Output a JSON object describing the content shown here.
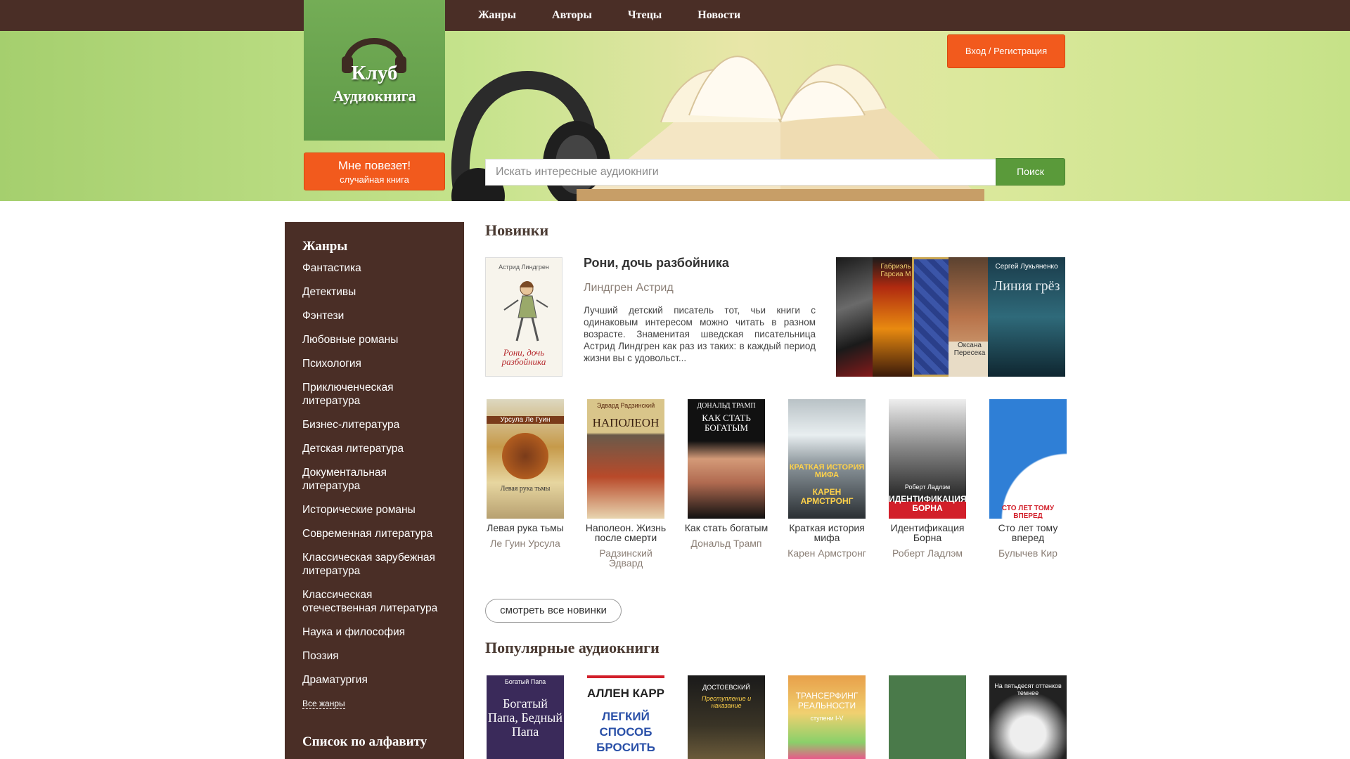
{
  "nav": {
    "items": [
      "Жанры",
      "Авторы",
      "Чтецы",
      "Новости"
    ]
  },
  "logo": {
    "title": "Клуб",
    "subtitle": "Аудиокнига",
    "icon": "headphones-icon"
  },
  "lucky": {
    "main": "Мне повезет!",
    "sub": "случайная книга"
  },
  "login": {
    "label": "Вход / Регистрация"
  },
  "search": {
    "placeholder": "Искать интересные аудиокниги",
    "button": "Поиск"
  },
  "sidebar": {
    "genres_heading": "Жанры",
    "genres": [
      "Фантастика",
      "Детективы",
      "Фэнтези",
      "Любовные романы",
      "Психология",
      "Приключенческая литература",
      "Бизнес-литература",
      "Детская литература",
      "Документальная литература",
      "Исторические романы",
      "Современная литература",
      "Классическая зарубежная литература",
      "Классическая отечественная литература",
      "Наука и философия",
      "Поэзия",
      "Драматургия"
    ],
    "all_genres": "Все жанры",
    "alphabet_heading": "Список по алфавиту"
  },
  "new_section": {
    "title": "Новинки",
    "featured": {
      "title": "Рони, дочь разбойника",
      "author": "Линдгрен Астрид",
      "description": "Лучший детский писатель тот, чьи книги с одинаковым интересом можно читать в разном возрасте. Знаменитая шведская писательница Астрид Линдгрен как раз из таких: в каждый период жизни вы с удовольст...",
      "cover_author": "Астрид Линдгрен",
      "cover_title": "Рони, дочь разбойника"
    },
    "stack_covers": [
      {
        "text": "Габриэль Гарсиа М"
      },
      {
        "text": "Оксана Пересека"
      },
      {
        "text": "Сергей Лукьяненко"
      },
      {
        "text": "Линия грёз"
      }
    ],
    "books": [
      {
        "title": "Левая рука тьмы",
        "author": "Ле Гуин Урсула",
        "cover_top": "Урсула Ле Гуин",
        "cover_bottom": "Левая рука тьмы"
      },
      {
        "title": "Наполеон. Жизнь после смерти",
        "author": "Радзинский Эдвард",
        "cover_top": "Эдвард Радзинский",
        "cover_bottom": "НАПОЛЕОН"
      },
      {
        "title": "Как стать богатым",
        "author": "Дональд Трамп",
        "cover_top": "ДОНАЛЬД ТРАМП",
        "cover_bottom": "КАК СТАТЬ БОГАТЫМ"
      },
      {
        "title": "Краткая история мифа",
        "author": "Карен Армстронг",
        "cover_top": "КРАТКАЯ ИСТОРИЯ МИФА",
        "cover_bottom": "КАРЕН АРМСТРОНГ"
      },
      {
        "title": "Идентификация Борна",
        "author": "Роберт Ладлэм",
        "cover_top": "Роберт Ладлэм",
        "cover_bottom": "ИДЕНТИФИКАЦИЯ БОРНА"
      },
      {
        "title": "Сто лет тому вперед",
        "author": "Булычев Кир",
        "cover_top": "",
        "cover_bottom": "СТО ЛЕТ ТОМУ ВПЕРЕД"
      }
    ],
    "more_button": "смотреть все новинки"
  },
  "popular_section": {
    "title": "Популярные аудиокниги",
    "covers": [
      {
        "top": "Богатый Папа",
        "main": "Богатый Папа, Бедный Папа"
      },
      {
        "top": "АЛЛЕН КАРР",
        "main": "ЛЕГКИЙ СПОСОБ БРОСИТЬ"
      },
      {
        "top": "ДОСТОЕВСКИЙ",
        "main": "Преступление и наказание"
      },
      {
        "top": "ТРАНСЕРФИНГ РЕАЛЬНОСТИ",
        "main": "ступени I-V"
      },
      {
        "top": "",
        "main": ""
      },
      {
        "top": "На пятьдесят оттенков темнее",
        "main": ""
      }
    ]
  },
  "colors": {
    "brown": "#4a2e26",
    "orange": "#f25a1d",
    "green": "#5a9a3a",
    "hero_green": "#a5cf6e"
  }
}
